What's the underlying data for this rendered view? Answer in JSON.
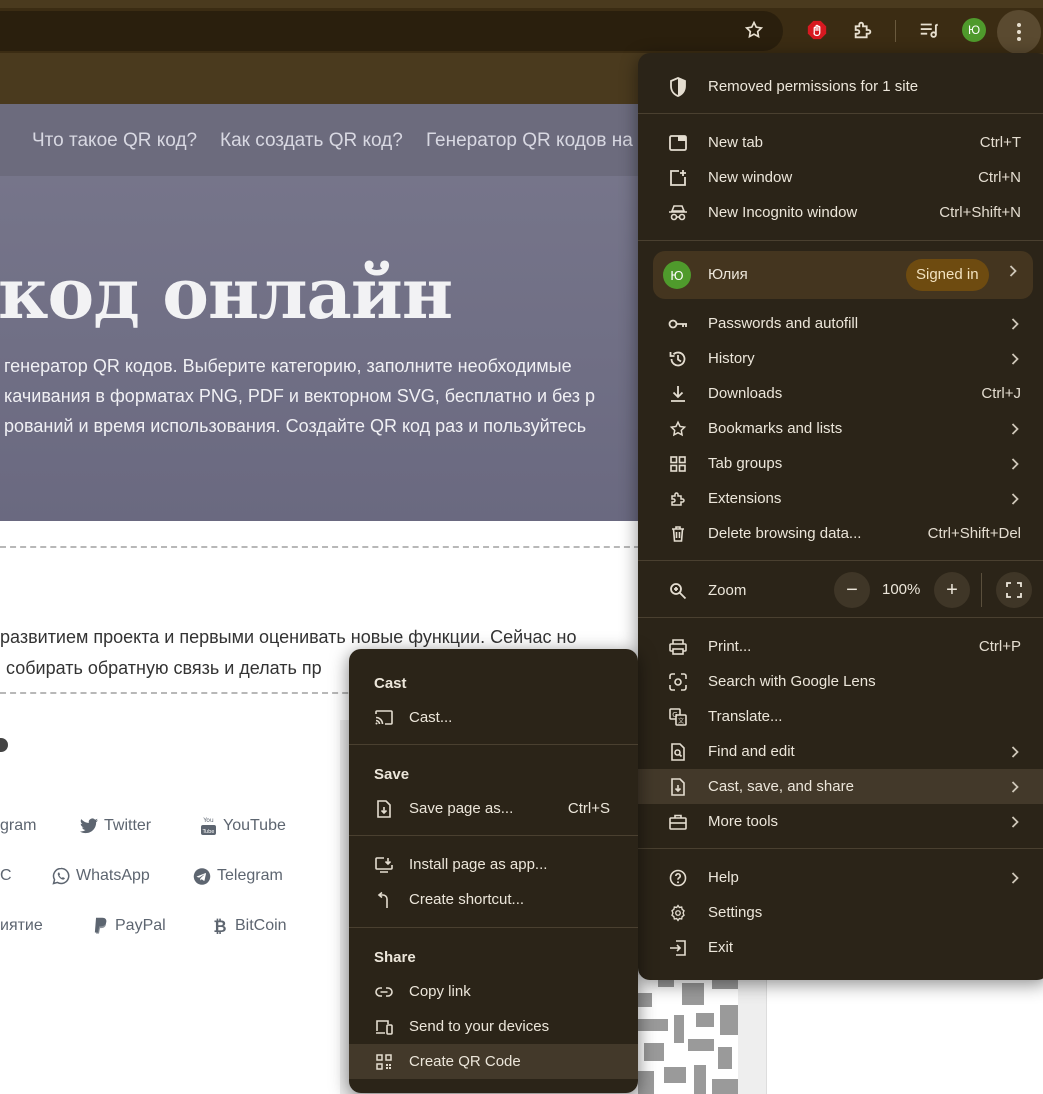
{
  "browser": {
    "profile_initial": "Ю"
  },
  "page": {
    "nav": [
      "Что такое QR код?",
      "Как создать QR код?",
      "Генератор QR кодов на"
    ],
    "hero_title": "код онлайн",
    "hero_lines": [
      "генератор QR кодов. Выберите категорию, заполните необходимые",
      "качивания в форматах PNG, PDF и векторном SVG, бесплатно и без р",
      "рований и время использования. Создайте QR код раз и пользуйтесь"
    ],
    "notice_lines": [
      "развитием проекта и первыми оценивать новые функции. Сейчас но",
      "собирать обратную связь и делать пр"
    ],
    "categories": [
      {
        "label": "gram",
        "icon": "instagram-icon"
      },
      {
        "label": "Twitter",
        "icon": "twitter-icon"
      },
      {
        "label": "YouTube",
        "icon": "youtube-icon"
      },
      {
        "label": "C",
        "icon": ""
      },
      {
        "label": "WhatsApp",
        "icon": "whatsapp-icon"
      },
      {
        "label": "Telegram",
        "icon": "telegram-icon"
      },
      {
        "label": "иятие",
        "icon": ""
      },
      {
        "label": "PayPal",
        "icon": "paypal-icon"
      },
      {
        "label": "BitCoin",
        "icon": "bitcoin-icon"
      }
    ]
  },
  "menu": {
    "removed_permissions": "Removed permissions for 1 site",
    "new_tab": {
      "label": "New tab",
      "shortcut": "Ctrl+T"
    },
    "new_window": {
      "label": "New window",
      "shortcut": "Ctrl+N"
    },
    "new_incognito": {
      "label": "New Incognito window",
      "shortcut": "Ctrl+Shift+N"
    },
    "profile": {
      "initial": "Ю",
      "name": "Юлия",
      "status": "Signed in"
    },
    "passwords": "Passwords and autofill",
    "history": "History",
    "downloads": {
      "label": "Downloads",
      "shortcut": "Ctrl+J"
    },
    "bookmarks": "Bookmarks and lists",
    "tab_groups": "Tab groups",
    "extensions": "Extensions",
    "delete_data": {
      "label": "Delete browsing data...",
      "shortcut": "Ctrl+Shift+Del"
    },
    "zoom": {
      "label": "Zoom",
      "value": "100%",
      "minus": "−",
      "plus": "+"
    },
    "print": {
      "label": "Print...",
      "shortcut": "Ctrl+P"
    },
    "google_lens": "Search with Google Lens",
    "translate": "Translate...",
    "find_edit": "Find and edit",
    "cast_save_share": "Cast, save, and share",
    "more_tools": "More tools",
    "help": "Help",
    "settings": "Settings",
    "exit": "Exit"
  },
  "submenu": {
    "cast_header": "Cast",
    "cast": "Cast...",
    "save_header": "Save",
    "save_page": {
      "label": "Save page as...",
      "shortcut": "Ctrl+S"
    },
    "install_app": "Install page as app...",
    "create_shortcut": "Create shortcut...",
    "share_header": "Share",
    "copy_link": "Copy link",
    "send_devices": "Send to your devices",
    "create_qr": "Create QR Code"
  },
  "colors": {
    "menu_bg": "#2b2418",
    "menu_highlight": "#43392a",
    "toolbar": "#3b2c13",
    "signed_in_badge": "#6e4b10",
    "avatar": "#4f9a2c",
    "hero": "#76758a"
  }
}
